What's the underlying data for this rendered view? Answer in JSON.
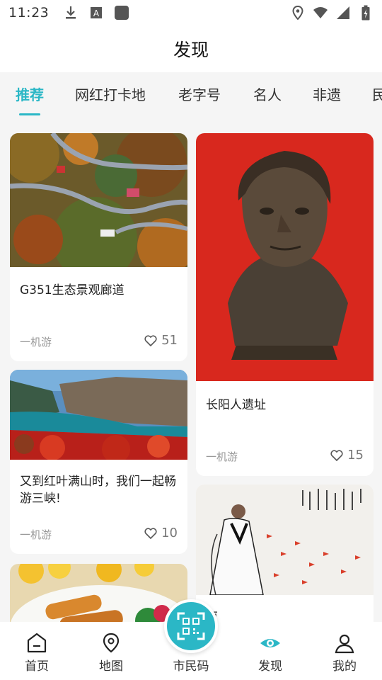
{
  "status": {
    "time": "11:23",
    "icons": [
      "download-icon",
      "a-icon",
      "square-icon",
      "location-icon",
      "wifi-icon",
      "signal-icon",
      "battery-icon"
    ]
  },
  "header": {
    "title": "发现"
  },
  "tabs": [
    {
      "label": "推荐",
      "active": true
    },
    {
      "label": "网红打卡地"
    },
    {
      "label": "老字号"
    },
    {
      "label": "名人"
    },
    {
      "label": "非遗"
    },
    {
      "label": "民"
    }
  ],
  "cards": [
    {
      "title": "G351生态景观廊道",
      "source": "一机游",
      "likes": "51"
    },
    {
      "title": "长阳人遗址",
      "source": "一机游",
      "likes": "15"
    },
    {
      "title": "又到红叶满山时，我们一起畅游三峡!",
      "source": "一机游",
      "likes": "10"
    },
    {
      "title": "原"
    }
  ],
  "nav": [
    {
      "label": "首页",
      "icon": "home-icon"
    },
    {
      "label": "地图",
      "icon": "map-pin-icon"
    },
    {
      "label": "市民码",
      "icon": "qr-scan-icon"
    },
    {
      "label": "发现",
      "icon": "eye-icon",
      "active": true
    },
    {
      "label": "我的",
      "icon": "user-icon"
    }
  ],
  "colors": {
    "accent": "#2bb7c6"
  }
}
